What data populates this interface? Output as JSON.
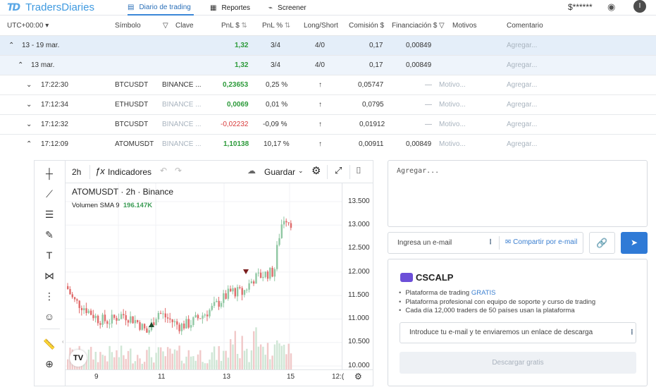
{
  "nav": {
    "logo_mark": "TD",
    "logo_text": "TradersDiaries",
    "items": [
      {
        "label": "Diario de trading",
        "icon": "journal-icon",
        "active": true
      },
      {
        "label": "Reportes",
        "icon": "reports-icon",
        "active": false
      },
      {
        "label": "Screener",
        "icon": "screener-icon",
        "active": false
      }
    ],
    "balance": "$******",
    "avatar": "I"
  },
  "table": {
    "headers": {
      "timezone": "UTC+00:00",
      "symbol": "Símbolo",
      "key": "Clave",
      "pnl_usd": "PnL $",
      "pnl_pct": "PnL %",
      "long_short": "Long/Short",
      "commission": "Comisión $",
      "funding": "Financiación $",
      "reasons": "Motivos",
      "comment": "Comentario"
    },
    "rows": [
      {
        "time": "13 - 19 mar.",
        "symbol": "",
        "key": "",
        "pnl": "1,32",
        "pnl_pct": "3/4",
        "ls": "4/0",
        "commission": "0,17",
        "funding": "0,00849",
        "reason": "",
        "comment": "Agregar..."
      },
      {
        "time": "13 mar.",
        "symbol": "",
        "key": "",
        "pnl": "1,32",
        "pnl_pct": "3/4",
        "ls": "4/0",
        "commission": "0,17",
        "funding": "0,00849",
        "reason": "",
        "comment": "Agregar..."
      },
      {
        "time": "17:22:30",
        "symbol": "BTCUSDT",
        "key": "BINANCE ...",
        "pnl": "0,23653",
        "pnl_pct": "0,25 %",
        "ls": "↑",
        "commission": "0,05747",
        "funding": "—",
        "reason": "Motivo...",
        "comment": "Agregar..."
      },
      {
        "time": "17:12:34",
        "symbol": "ETHUSDT",
        "key": "BINANCE ...",
        "pnl": "0,0069",
        "pnl_pct": "0,01 %",
        "ls": "↑",
        "commission": "0,0795",
        "funding": "—",
        "reason": "Motivo...",
        "comment": "Agregar..."
      },
      {
        "time": "17:12:32",
        "symbol": "BTCUSDT",
        "key": "BINANCE ...",
        "pnl": "-0,02232",
        "pnl_pct": "-0,09 %",
        "ls": "↑",
        "commission": "0,01912",
        "funding": "—",
        "reason": "Motivo...",
        "comment": "Agregar..."
      },
      {
        "time": "17:12:09",
        "symbol": "ATOMUSDT",
        "key": "BINANCE ...",
        "pnl": "1,10138",
        "pnl_pct": "10,17 %",
        "ls": "↑",
        "commission": "0,00911",
        "funding": "0,00849",
        "reason": "Motivo...",
        "comment": "Agregar..."
      }
    ]
  },
  "chart": {
    "interval": "2h",
    "indicators_label": "Indicadores",
    "save_label": "Guardar",
    "legend_title": "ATOMUSDT · 2h · Binance",
    "volume_label": "Volumen SMA 9",
    "volume_value": "196.147K",
    "price_ticks": [
      "13.500",
      "13.000",
      "12.500",
      "12.000",
      "11.500",
      "11.000",
      "10.500",
      "10.000"
    ],
    "time_ticks": [
      "9",
      "11",
      "13",
      "15",
      "12:("
    ],
    "up_color": "#8fc7a2",
    "down_color": "#e06b6b"
  },
  "comment_panel": {
    "placeholder": "Agregar...",
    "email_placeholder": "Ingresa un e-mail",
    "share_label": "Compartir por e-mail"
  },
  "promo": {
    "brand": "CSCALP",
    "bullet1": "Plataforma de trading ",
    "bullet1_link": "GRATIS",
    "bullet2": "Plataforma profesional con equipo de soporte y curso de trading",
    "bullet3": "Cada día 12,000 traders de 50 países usan la plataforma",
    "input_placeholder": "Introduce tu e-mail y te enviaremos un enlace de descarga",
    "button_label": "Descargar gratis"
  }
}
